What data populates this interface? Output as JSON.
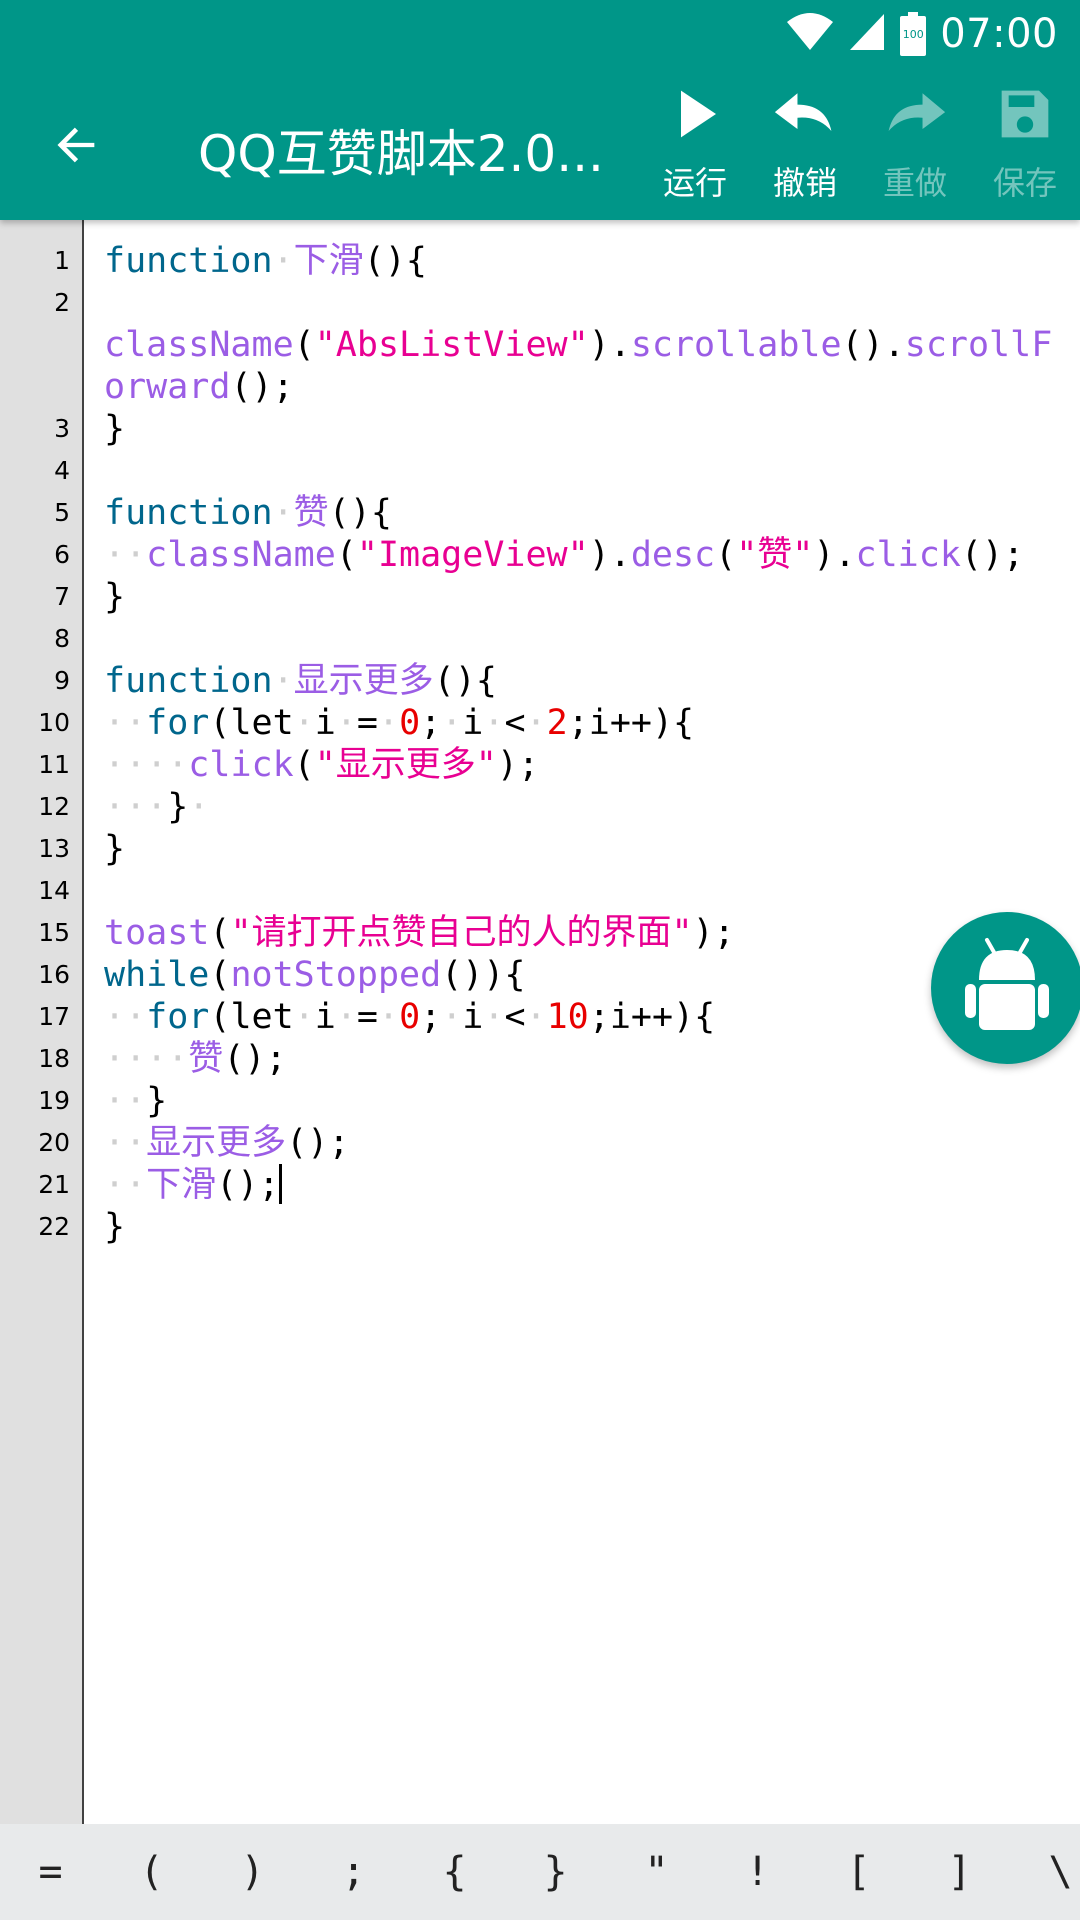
{
  "status": {
    "time": "07:00",
    "battery": "100",
    "icons": [
      "wifi-icon",
      "signal-icon",
      "battery-icon"
    ]
  },
  "toolbar": {
    "title": "QQ互赞脚本2.0...",
    "actions": [
      {
        "label": "运行",
        "icon": "play-icon",
        "enabled": true
      },
      {
        "label": "撤销",
        "icon": "undo-icon",
        "enabled": true
      },
      {
        "label": "重做",
        "icon": "redo-icon",
        "enabled": false
      },
      {
        "label": "保存",
        "icon": "save-icon",
        "enabled": false
      }
    ]
  },
  "editor": {
    "cursor_line": 21,
    "rows": [
      {
        "num": "1",
        "tokens": [
          [
            "kw",
            "function"
          ],
          [
            "ws",
            "·"
          ],
          [
            "fn",
            "下滑"
          ],
          [
            "pl",
            "(){"
          ]
        ]
      },
      {
        "num": "2",
        "tokens": []
      },
      {
        "num": "",
        "tokens": [
          [
            "fn",
            "className"
          ],
          [
            "pl",
            "("
          ],
          [
            "str",
            "\"AbsListView\""
          ],
          [
            "pl",
            ")."
          ],
          [
            "fn",
            "scrollable"
          ],
          [
            "pl",
            "()."
          ],
          [
            "fn",
            "scrollF"
          ]
        ]
      },
      {
        "num": "",
        "tokens": [
          [
            "fn",
            "orward"
          ],
          [
            "pl",
            "();"
          ]
        ]
      },
      {
        "num": "3",
        "tokens": [
          [
            "pl",
            "}"
          ]
        ]
      },
      {
        "num": "4",
        "tokens": []
      },
      {
        "num": "5",
        "tokens": [
          [
            "kw",
            "function"
          ],
          [
            "ws",
            "·"
          ],
          [
            "fn",
            "赞"
          ],
          [
            "pl",
            "(){"
          ]
        ]
      },
      {
        "num": "6",
        "tokens": [
          [
            "ws",
            "··"
          ],
          [
            "fn",
            "className"
          ],
          [
            "pl",
            "("
          ],
          [
            "str",
            "\"ImageView\""
          ],
          [
            "pl",
            ")."
          ],
          [
            "fn",
            "desc"
          ],
          [
            "pl",
            "("
          ],
          [
            "str",
            "\"赞\""
          ],
          [
            "pl",
            ")."
          ],
          [
            "fn",
            "click"
          ],
          [
            "pl",
            "();"
          ]
        ]
      },
      {
        "num": "7",
        "tokens": [
          [
            "pl",
            "}"
          ]
        ]
      },
      {
        "num": "8",
        "tokens": []
      },
      {
        "num": "9",
        "tokens": [
          [
            "kw",
            "function"
          ],
          [
            "ws",
            "·"
          ],
          [
            "fn",
            "显示更多"
          ],
          [
            "pl",
            "(){"
          ]
        ]
      },
      {
        "num": "10",
        "tokens": [
          [
            "ws",
            "··"
          ],
          [
            "kw",
            "for"
          ],
          [
            "pl",
            "(let"
          ],
          [
            "ws",
            "·"
          ],
          [
            "pl",
            "i"
          ],
          [
            "ws",
            "·"
          ],
          [
            "pl",
            "="
          ],
          [
            "ws",
            "·"
          ],
          [
            "num",
            "0"
          ],
          [
            "pl",
            ";"
          ],
          [
            "ws",
            "·"
          ],
          [
            "pl",
            "i"
          ],
          [
            "ws",
            "·"
          ],
          [
            "pl",
            "<"
          ],
          [
            "ws",
            "·"
          ],
          [
            "num",
            "2"
          ],
          [
            "pl",
            ";i++){"
          ]
        ]
      },
      {
        "num": "11",
        "tokens": [
          [
            "ws",
            "····"
          ],
          [
            "fn",
            "click"
          ],
          [
            "pl",
            "("
          ],
          [
            "str",
            "\"显示更多\""
          ],
          [
            "pl",
            ");"
          ]
        ]
      },
      {
        "num": "12",
        "tokens": [
          [
            "ws",
            "···"
          ],
          [
            "pl",
            "}"
          ],
          [
            "ws",
            "·"
          ]
        ]
      },
      {
        "num": "13",
        "tokens": [
          [
            "pl",
            "}"
          ]
        ]
      },
      {
        "num": "14",
        "tokens": []
      },
      {
        "num": "15",
        "tokens": [
          [
            "fn",
            "toast"
          ],
          [
            "pl",
            "("
          ],
          [
            "str",
            "\"请打开点赞自己的人的界面\""
          ],
          [
            "pl",
            ");"
          ]
        ]
      },
      {
        "num": "16",
        "tokens": [
          [
            "kw",
            "while"
          ],
          [
            "pl",
            "("
          ],
          [
            "fn",
            "notStopped"
          ],
          [
            "pl",
            "()){"
          ]
        ]
      },
      {
        "num": "17",
        "tokens": [
          [
            "ws",
            "··"
          ],
          [
            "kw",
            "for"
          ],
          [
            "pl",
            "(let"
          ],
          [
            "ws",
            "·"
          ],
          [
            "pl",
            "i"
          ],
          [
            "ws",
            "·"
          ],
          [
            "pl",
            "="
          ],
          [
            "ws",
            "·"
          ],
          [
            "num",
            "0"
          ],
          [
            "pl",
            ";"
          ],
          [
            "ws",
            "·"
          ],
          [
            "pl",
            "i"
          ],
          [
            "ws",
            "·"
          ],
          [
            "pl",
            "<"
          ],
          [
            "ws",
            "·"
          ],
          [
            "num",
            "10"
          ],
          [
            "pl",
            ";i++){"
          ]
        ]
      },
      {
        "num": "18",
        "tokens": [
          [
            "ws",
            "····"
          ],
          [
            "fn",
            "赞"
          ],
          [
            "pl",
            "();"
          ]
        ]
      },
      {
        "num": "19",
        "tokens": [
          [
            "ws",
            "··"
          ],
          [
            "pl",
            "}"
          ]
        ]
      },
      {
        "num": "20",
        "tokens": [
          [
            "ws",
            "··"
          ],
          [
            "fn",
            "显示更多"
          ],
          [
            "pl",
            "();"
          ]
        ]
      },
      {
        "num": "21",
        "tokens": [
          [
            "ws",
            "··"
          ],
          [
            "fn",
            "下滑"
          ],
          [
            "pl",
            "();"
          ]
        ]
      },
      {
        "num": "22",
        "tokens": [
          [
            "pl",
            "}"
          ]
        ]
      }
    ]
  },
  "fab": {
    "icon": "android-robot-icon"
  },
  "symbols": [
    "=",
    "(",
    ")",
    ";",
    "{",
    "}",
    "\"",
    "!",
    "[",
    "]",
    "\\"
  ],
  "colors": {
    "primary": "#009688",
    "keyword": "#00668c",
    "function": "#9b5de5",
    "string": "#e80092",
    "number": "#e80000",
    "gutter": "#e0e0e0",
    "symbar": "#e8eaeb"
  }
}
